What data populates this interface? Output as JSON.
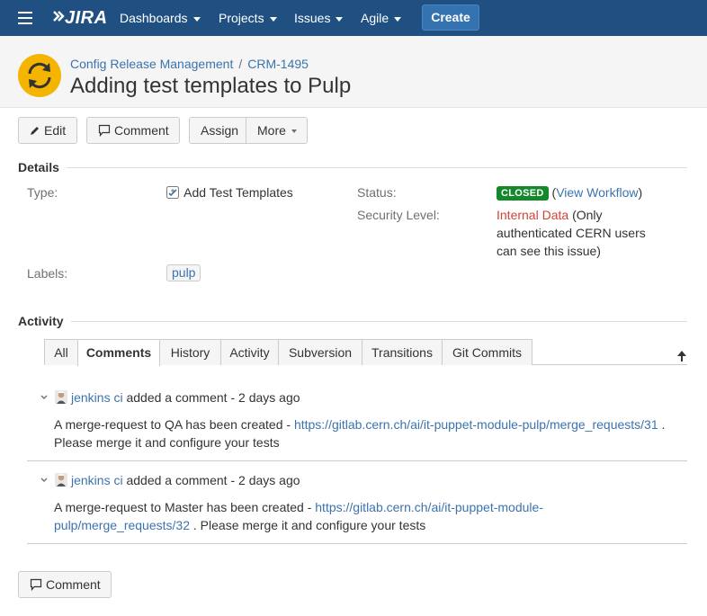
{
  "nav": {
    "logo_text": "JIRA",
    "items": [
      {
        "label": "Dashboards"
      },
      {
        "label": "Projects"
      },
      {
        "label": "Issues"
      },
      {
        "label": "Agile"
      }
    ],
    "create_label": "Create"
  },
  "header": {
    "project_name": "Config Release Management",
    "issue_key": "CRM-1495",
    "title": "Adding test templates to Pulp"
  },
  "toolbar": {
    "edit_label": "Edit",
    "comment_label": "Comment",
    "assign_label": "Assign",
    "more_label": "More"
  },
  "details": {
    "section_label": "Details",
    "type_label": "Type:",
    "type_value": "Add Test Templates",
    "status_label": "Status:",
    "status_value": "CLOSED",
    "view_workflow": "View Workflow",
    "security_label": "Security Level:",
    "security_value": "Internal Data",
    "security_note": "(Only authenticated CERN users can see this issue)",
    "labels_label": "Labels:",
    "label_value": "pulp"
  },
  "activity": {
    "section_label": "Activity",
    "tabs": [
      {
        "label": "All"
      },
      {
        "label": "Comments"
      },
      {
        "label": "History"
      },
      {
        "label": "Activity"
      },
      {
        "label": "Subversion"
      },
      {
        "label": "Transitions"
      },
      {
        "label": "Git Commits"
      }
    ],
    "active_tab": "Comments",
    "comments": [
      {
        "author": "jenkins ci",
        "action": "added a comment",
        "time": "2 days ago",
        "text_before": "A merge-request to QA has been created -",
        "link": "https://gitlab.cern.ch/ai/it-puppet-module-pulp/merge_requests/31",
        "text_after": ". Please merge it and configure your tests"
      },
      {
        "author": "jenkins ci",
        "action": "added a comment",
        "time": "2 days ago",
        "text_before": "A merge-request to Master has been created -",
        "link": "https://gitlab.cern.ch/ai/it-puppet-module-pulp/merge_requests/32",
        "text_after": ". Please merge it and configure your tests"
      }
    ],
    "comment_button_label": "Comment"
  },
  "colors": {
    "nav_bg": "#205081",
    "create_bg": "#3572b0",
    "link": "#3b73af",
    "status_closed": "#14892c",
    "security_red": "#d04437"
  }
}
